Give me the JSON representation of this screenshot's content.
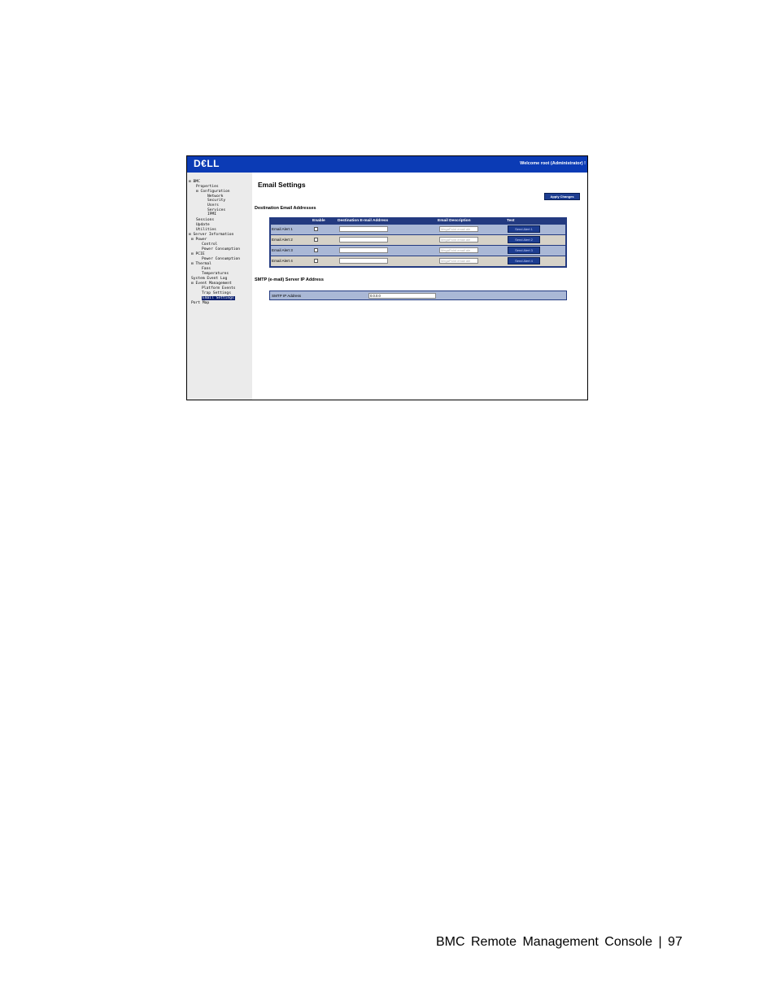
{
  "header": {
    "logo": "D€LL",
    "welcome": "Welcome root (Administrator) !"
  },
  "sidebar": {
    "items": [
      {
        "text": "⊟  BMC"
      },
      {
        "text": "Properties"
      },
      {
        "text": "⊟  Configuration"
      },
      {
        "text": "Network"
      },
      {
        "text": "Security"
      },
      {
        "text": "Users"
      },
      {
        "text": "Services"
      },
      {
        "text": "IPMI"
      },
      {
        "text": "Sessions"
      },
      {
        "text": "Update"
      },
      {
        "text": "Utilities"
      },
      {
        "text": "⊟  Server Information"
      },
      {
        "text": "⊟  Power"
      },
      {
        "text": "Control"
      },
      {
        "text": "Power Consumption"
      },
      {
        "text": "⊟  PCIE"
      },
      {
        "text": "Power Consumption"
      },
      {
        "text": "⊟  Thermal"
      },
      {
        "text": "Fans"
      },
      {
        "text": "Temperatures"
      },
      {
        "text": "System Event Log"
      },
      {
        "text": "⊟  Event Management"
      },
      {
        "text": "Platform Events"
      },
      {
        "text": "Trap Settings"
      },
      {
        "text": "Email Settings"
      },
      {
        "text": "Port Map"
      }
    ]
  },
  "main": {
    "title": "Email Settings",
    "apply_label": "Apply Changes",
    "dest_title": "Destination Email Addresses",
    "columns": [
      "Enable",
      "Destination E-mail Address",
      "Email Description",
      "Test"
    ],
    "rows": [
      {
        "label": "Email Alert 1",
        "description": "MegaPoint email ale",
        "send_label": "Send Alert 1"
      },
      {
        "label": "Email Alert 2",
        "description": "MegaPoint email ale",
        "send_label": "Send Alert 2"
      },
      {
        "label": "Email Alert 3",
        "description": "MegaPoint email ale",
        "send_label": "Send Alert 3"
      },
      {
        "label": "Email Alert 4",
        "description": "MegaPoint email ale",
        "send_label": "Send Alert 4"
      }
    ],
    "smtp_title": "SMTP (e-mail) Server IP Address",
    "smtp_label": "SMTP IP Address",
    "smtp_value": "0.0.0.0"
  },
  "footer": {
    "text": "BMC Remote Management Console | 97"
  },
  "colors": {
    "header_bg": "#0b3bb5",
    "table_header": "#233a80",
    "row_a": "#aab8d6",
    "row_b": "#d6d2c8",
    "sidebar_bg": "#ebebeb"
  }
}
